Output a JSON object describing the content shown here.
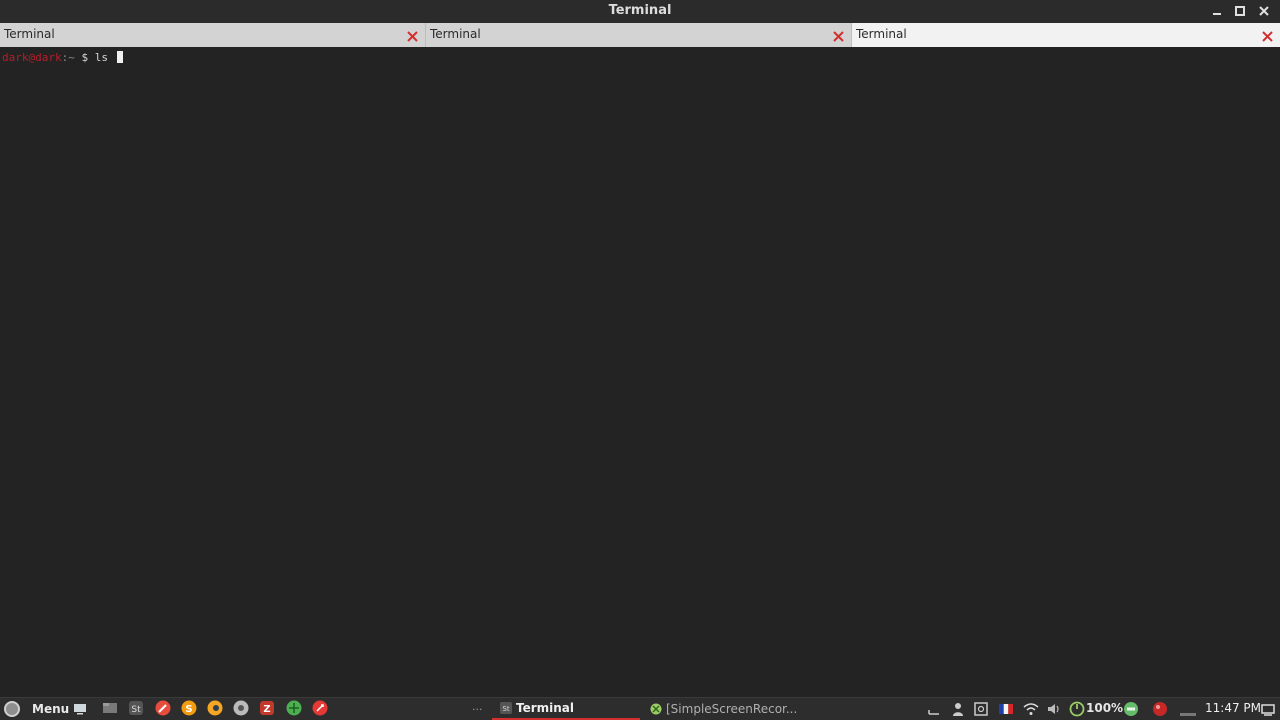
{
  "window": {
    "title": "Terminal"
  },
  "tabs": [
    {
      "label": "Terminal",
      "active": false
    },
    {
      "label": "Terminal",
      "active": false
    },
    {
      "label": "Terminal",
      "active": true
    }
  ],
  "terminal": {
    "prompt_user": "dark@dark",
    "prompt_path": ":~",
    "prompt_symbol": "$",
    "command": "ls"
  },
  "panel": {
    "menu_label": "Menu",
    "launchers": [
      "show-desktop-icon",
      "files-icon",
      "sublime-icon",
      "text-editor-icon",
      "s-app-icon",
      "blender-icon",
      "chrome-icon",
      "filezilla-icon",
      "android-icon",
      "rocket-icon"
    ],
    "overflow": "...",
    "tasks": [
      {
        "label": "Terminal",
        "active": true
      },
      {
        "label": "[SimpleScreenRecor...",
        "active": false
      }
    ],
    "battery": "100%",
    "clock": "11:47 PM"
  },
  "colors": {
    "accent": "#d32f2f",
    "prompt_user": "#b21f2a",
    "terminal_bg": "#232323",
    "panel_bg": "#2d2d2d"
  }
}
